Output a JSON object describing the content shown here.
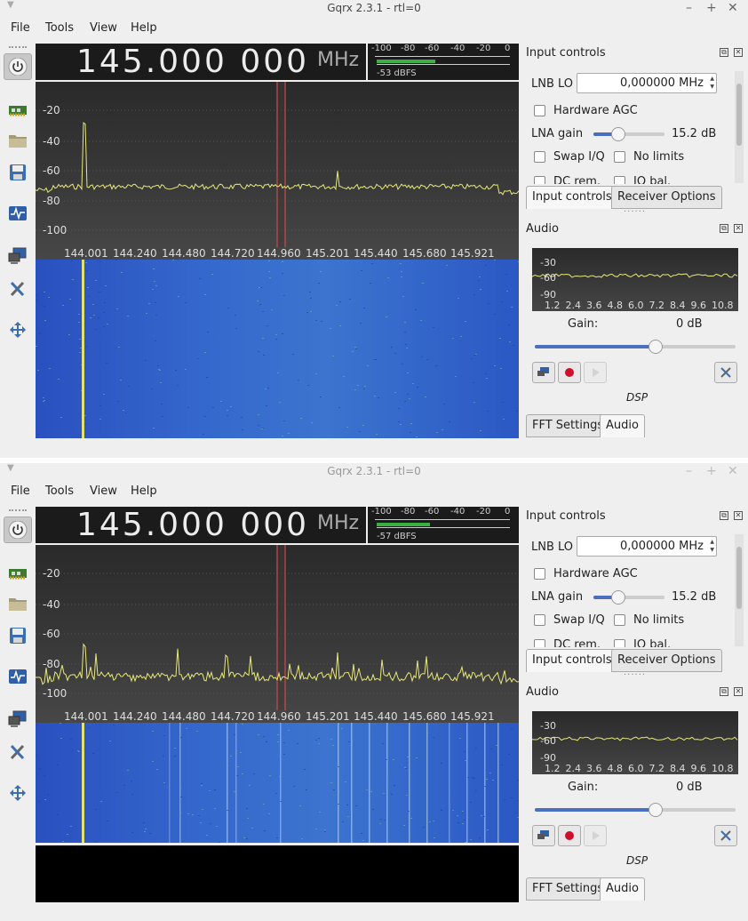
{
  "windows": [
    {
      "title": "Gqrx 2.3.1 - rtl=0",
      "menu": [
        "File",
        "Tools",
        "View",
        "Help"
      ],
      "frequency": "145.000 000",
      "unit": "MHz",
      "meter_ticks": [
        "-100",
        "-80",
        "-60",
        "-40",
        "-20",
        "0"
      ],
      "meter_level_fraction": 0.44,
      "meter_readout": "-53 dBFS",
      "yticks": [
        "-20",
        "-40",
        "-60",
        "-80",
        "-100"
      ],
      "xticks": [
        "144.001",
        "144.240",
        "144.480",
        "144.720",
        "144.960",
        "145.201",
        "145.440",
        "145.680",
        "145.921"
      ],
      "input_controls": {
        "title": "Input controls",
        "lnb_lo_label": "LNB LO",
        "lnb_lo_value": "0,000000 MHz",
        "hw_agc": "Hardware AGC",
        "lna_gain_label": "LNA gain",
        "lna_gain_value": "15.2 dB",
        "lna_gain_fraction": 0.35,
        "swap_iq": "Swap I/Q",
        "no_limits": "No limits",
        "dc_rem": "DC rem.",
        "iq_bal": "IQ bal."
      },
      "tabs_top": [
        "Input controls",
        "Receiver Options"
      ],
      "audio": {
        "title": "Audio",
        "yticks": [
          "-30",
          "-60",
          "-90"
        ],
        "xticks": [
          "1.2",
          "2.4",
          "3.6",
          "4.8",
          "6.0",
          "7.2",
          "8.4",
          "9.6",
          "10.8"
        ],
        "gain_label": "Gain:",
        "gain_value": "0 dB",
        "gain_fraction": 0.6,
        "dsp": "DSP"
      },
      "tabs_bottom": [
        "FFT Settings",
        "Audio"
      ]
    },
    {
      "title": "Gqrx 2.3.1 - rtl=0",
      "menu": [
        "File",
        "Tools",
        "View",
        "Help"
      ],
      "frequency": "145.000 000",
      "unit": "MHz",
      "meter_ticks": [
        "-100",
        "-80",
        "-60",
        "-40",
        "-20",
        "0"
      ],
      "meter_level_fraction": 0.4,
      "meter_readout": "-57 dBFS",
      "yticks": [
        "-20",
        "-40",
        "-60",
        "-80",
        "-100"
      ],
      "xticks": [
        "144.001",
        "144.240",
        "144.480",
        "144.720",
        "144.960",
        "145.201",
        "145.440",
        "145.680",
        "145.921"
      ],
      "input_controls": {
        "title": "Input controls",
        "lnb_lo_label": "LNB LO",
        "lnb_lo_value": "0,000000 MHz",
        "hw_agc": "Hardware AGC",
        "lna_gain_label": "LNA gain",
        "lna_gain_value": "15.2 dB",
        "lna_gain_fraction": 0.35,
        "swap_iq": "Swap I/Q",
        "no_limits": "No limits",
        "dc_rem": "DC rem.",
        "iq_bal": "IQ bal."
      },
      "tabs_top": [
        "Input controls",
        "Receiver Options"
      ],
      "audio": {
        "title": "Audio",
        "yticks": [
          "-30",
          "-60",
          "-90"
        ],
        "xticks": [
          "1.2",
          "2.4",
          "3.6",
          "4.8",
          "6.0",
          "7.2",
          "8.4",
          "9.6",
          "10.8"
        ],
        "gain_label": "Gain:",
        "gain_value": "0 dB",
        "gain_fraction": 0.6,
        "dsp": "DSP"
      },
      "tabs_bottom": [
        "FFT Settings",
        "Audio"
      ]
    }
  ],
  "colors": {
    "trace": "#e8e87a",
    "waterfall": "#2c56c7",
    "marker": "#e05050",
    "meter": "#3cb043"
  }
}
